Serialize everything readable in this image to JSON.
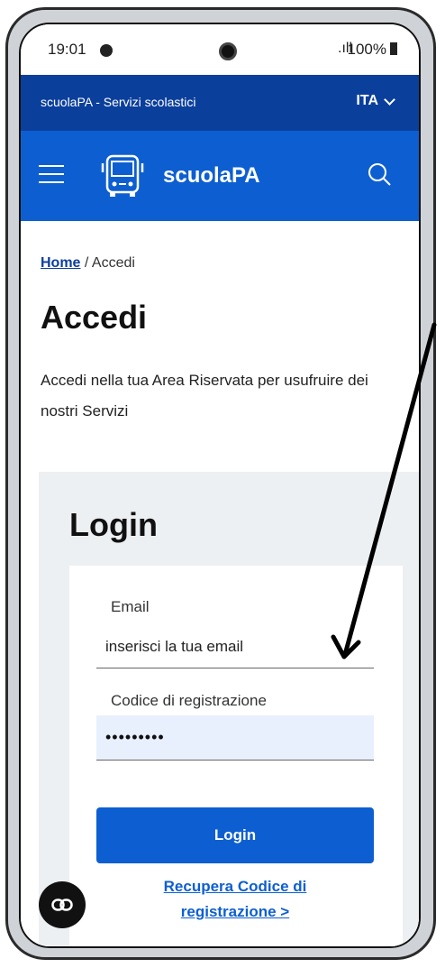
{
  "status_bar": {
    "time": "19:01",
    "signal": ".ıll",
    "battery": "100%"
  },
  "topbar": {
    "title": "scuolaPA - Servizi scolastici",
    "language": "ITA"
  },
  "header": {
    "brand": "scuolaPA",
    "icons": [
      "menu-icon",
      "bus-icon",
      "search-icon"
    ]
  },
  "breadcrumb": {
    "home": "Home",
    "separator": "/",
    "current": "Accedi"
  },
  "page": {
    "title": "Accedi",
    "intro": "Accedi nella tua Area Riservata per usufruire dei nostri Servizi"
  },
  "login": {
    "title": "Login",
    "email_label": "Email",
    "email_placeholder": "inserisci la tua email",
    "code_label": "Codice di registrazione",
    "code_value": "•••••••••",
    "button_label": "Login",
    "recover_line1": "Recupera Codice di",
    "recover_line2": "registrazione >"
  },
  "colors": {
    "topbar": "#0b3f9c",
    "header": "#0d5fd1",
    "panel": "#edf0f3",
    "button": "#0d5fd1"
  }
}
